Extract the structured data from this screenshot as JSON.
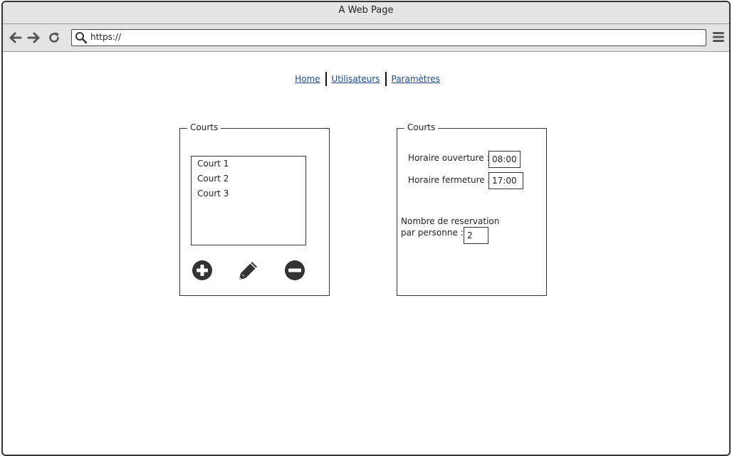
{
  "window": {
    "title": "A Web Page"
  },
  "browser": {
    "url": "https://",
    "icons": [
      "back-arrow-icon",
      "forward-arrow-icon",
      "reload-icon",
      "search-icon",
      "hamburger-menu-icon"
    ]
  },
  "nav": {
    "links": [
      "Home",
      "Utilisateurs",
      "Paramètres"
    ]
  },
  "courts_list_panel": {
    "legend": "Courts",
    "items": [
      "Court 1",
      "Court 2",
      "Court 3"
    ],
    "actions": [
      "add-circle-icon",
      "pencil-icon",
      "minus-circle-icon"
    ]
  },
  "courts_settings_panel": {
    "legend": "Courts",
    "opening_label": "Horaire ouverture :",
    "opening_value": "08:00",
    "closing_label": "Horaire fermeture :",
    "closing_value": "17:00",
    "reservations_label_line1": "Nombre de reservation",
    "reservations_label_line2": "par personne :",
    "reservations_value": "2"
  },
  "colors": {
    "link": "#1b4a8a",
    "chrome": "#e4e4e4",
    "icon": "#333333",
    "border": "#333333"
  }
}
